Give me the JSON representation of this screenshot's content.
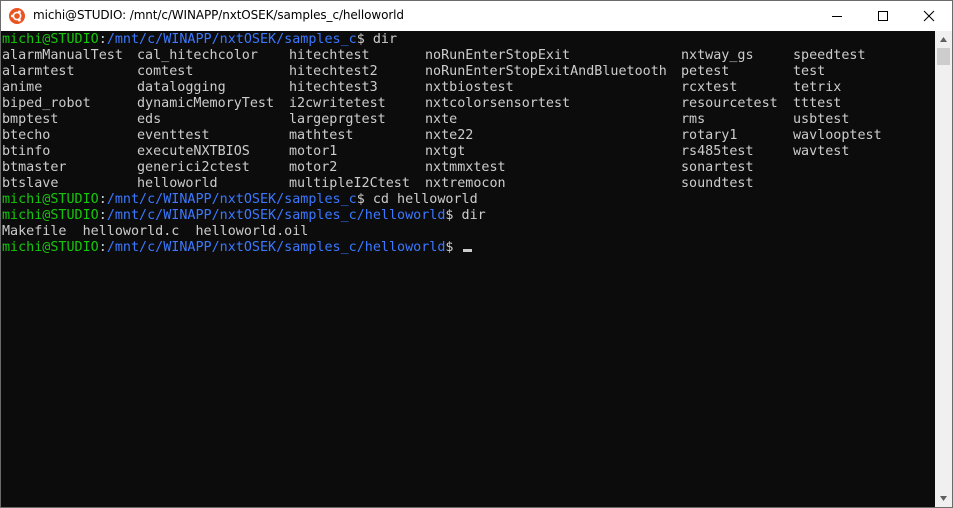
{
  "window": {
    "title": "michi@STUDIO: /mnt/c/WINAPP/nxtOSEK/samples_c/helloworld",
    "app_icon": "ubuntu-icon",
    "controls": {
      "minimize": "minimize-icon",
      "maximize": "maximize-icon",
      "close": "close-icon"
    }
  },
  "colors": {
    "background": "#0c0c0c",
    "user_host": "#16c60c",
    "path": "#3b78ff",
    "text": "#cccccc",
    "titlebar": "#ffffff"
  },
  "terminal": {
    "prompt1": {
      "user": "michi@STUDIO",
      "sep": ":",
      "path": "/mnt/c/WINAPP/nxtOSEK/samples_c",
      "symbol": "$",
      "command": " dir"
    },
    "listing_rows": [
      [
        "alarmManualTest",
        "cal_hitechcolor",
        "hitechtest",
        "noRunEnterStopExit",
        "nxtway_gs",
        "speedtest"
      ],
      [
        "alarmtest",
        "comtest",
        "hitechtest2",
        "noRunEnterStopExitAndBluetooth",
        "petest",
        "test"
      ],
      [
        "anime",
        "datalogging",
        "hitechtest3",
        "nxtbiostest",
        "rcxtest",
        "tetrix"
      ],
      [
        "biped_robot",
        "dynamicMemoryTest",
        "i2cwritetest",
        "nxtcolorsensortest",
        "resourcetest",
        "tttest"
      ],
      [
        "bmptest",
        "eds",
        "largeprgtest",
        "nxte",
        "rms",
        "usbtest"
      ],
      [
        "btecho",
        "eventtest",
        "mathtest",
        "nxte22",
        "rotary1",
        "wavlooptest"
      ],
      [
        "btinfo",
        "executeNXTBIOS",
        "motor1",
        "nxtgt",
        "rs485test",
        "wavtest"
      ],
      [
        "btmaster",
        "generici2ctest",
        "motor2",
        "nxtmmxtest",
        "sonartest",
        ""
      ],
      [
        "btslave",
        "helloworld",
        "multipleI2Ctest",
        "nxtremocon",
        "soundtest",
        ""
      ]
    ],
    "prompt2": {
      "user": "michi@STUDIO",
      "sep": ":",
      "path": "/mnt/c/WINAPP/nxtOSEK/samples_c",
      "symbol": "$",
      "command": " cd helloworld"
    },
    "prompt3": {
      "user": "michi@STUDIO",
      "sep": ":",
      "path": "/mnt/c/WINAPP/nxtOSEK/samples_c/helloworld",
      "symbol": "$",
      "command": " dir"
    },
    "dir_output": "Makefile  helloworld.c  helloworld.oil",
    "prompt4": {
      "user": "michi@STUDIO",
      "sep": ":",
      "path": "/mnt/c/WINAPP/nxtOSEK/samples_c/helloworld",
      "symbol": "$",
      "command": " "
    }
  },
  "scrollbar": {
    "up": "scroll-up-arrow-icon",
    "down": "scroll-down-arrow-icon"
  }
}
